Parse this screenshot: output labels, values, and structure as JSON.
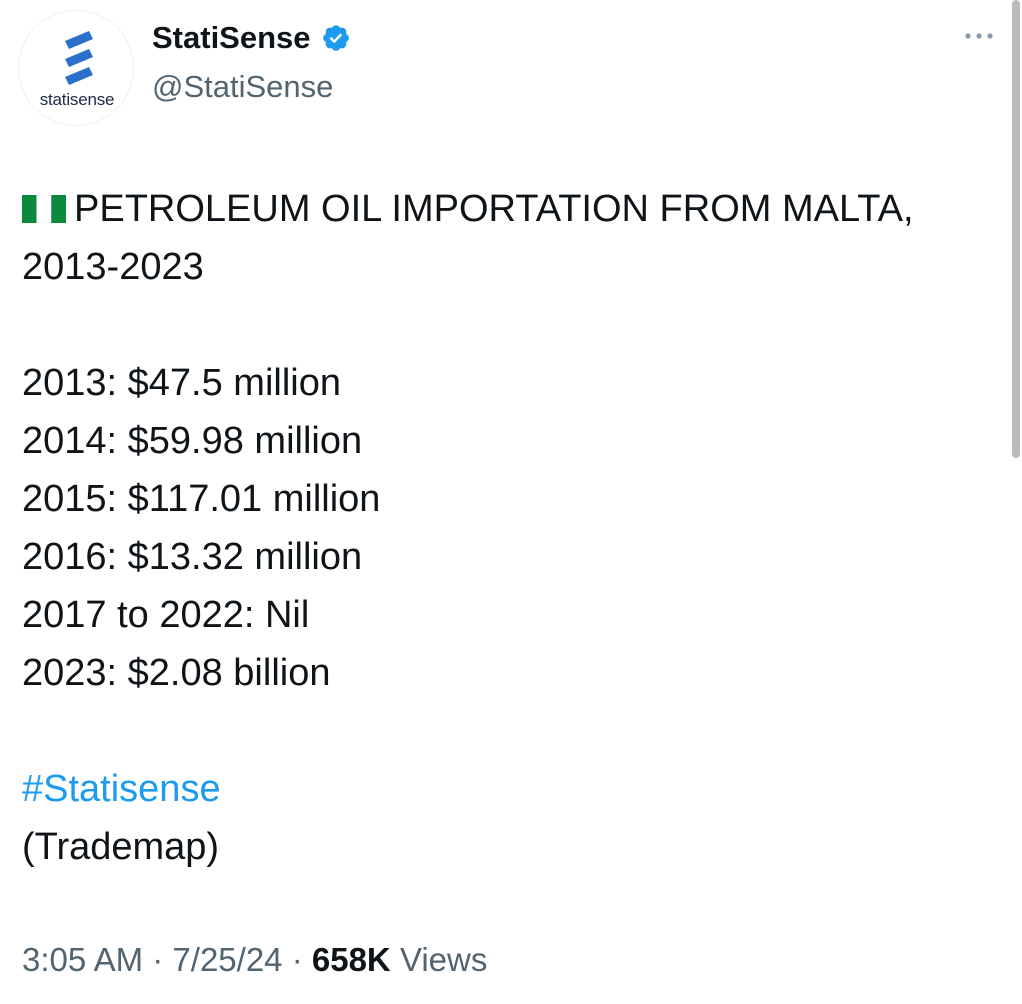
{
  "author": {
    "display_name": "StatiSense",
    "handle": "@StatiSense",
    "avatar_logo_text": "statisense",
    "verified_icon": "verified-badge-icon",
    "verified_color": "#1d9bf0"
  },
  "tweet": {
    "title": "PETROLEUM OIL IMPORTATION FROM MALTA,",
    "title_line2": "2013-2023",
    "flag_icon": "nigeria-flag-icon",
    "stats": [
      "2013: $47.5 million",
      "2014: $59.98 million",
      "2015: $117.01 million",
      "2016: $13.32 million",
      "2017 to 2022: Nil",
      "2023: $2.08 billion"
    ],
    "hashtag": "#Statisense",
    "source": "(Trademap)"
  },
  "meta": {
    "time": "3:05 AM",
    "date": "7/25/24",
    "separator": "·",
    "views_count": "658K",
    "views_label": "Views"
  },
  "colors": {
    "accent": "#1d9bf0",
    "secondary_text": "#536471",
    "primary_text": "#0f1419",
    "logo_blue": "#2a6fc9"
  }
}
